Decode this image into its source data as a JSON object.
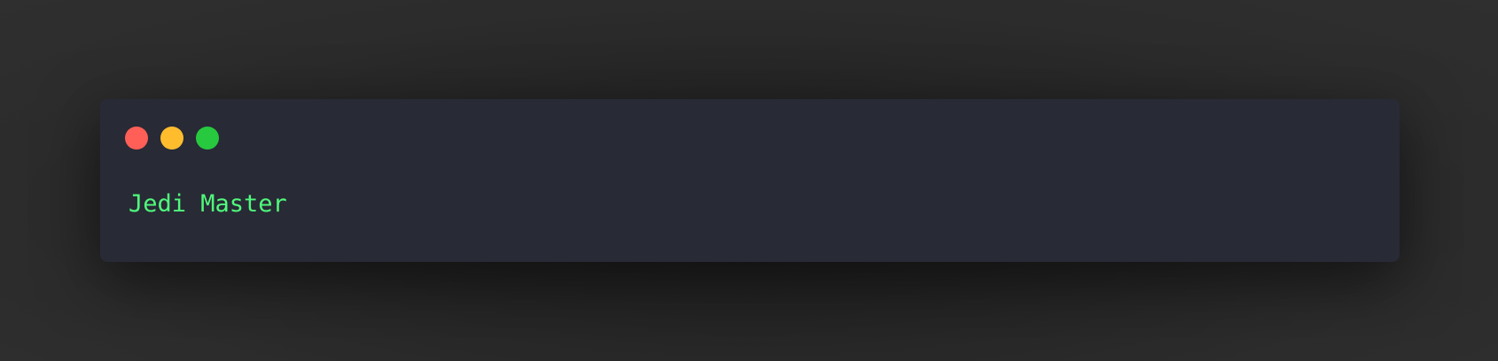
{
  "window": {
    "controls": [
      {
        "name": "close",
        "color": "#ff5f56"
      },
      {
        "name": "minimize",
        "color": "#ffbd2e"
      },
      {
        "name": "zoom",
        "color": "#27c93f"
      }
    ],
    "background_color": "#282a36"
  },
  "terminal": {
    "output": "Jedi Master",
    "text_color": "#50fa7b"
  },
  "page": {
    "background_color": "#2b2b2b"
  }
}
